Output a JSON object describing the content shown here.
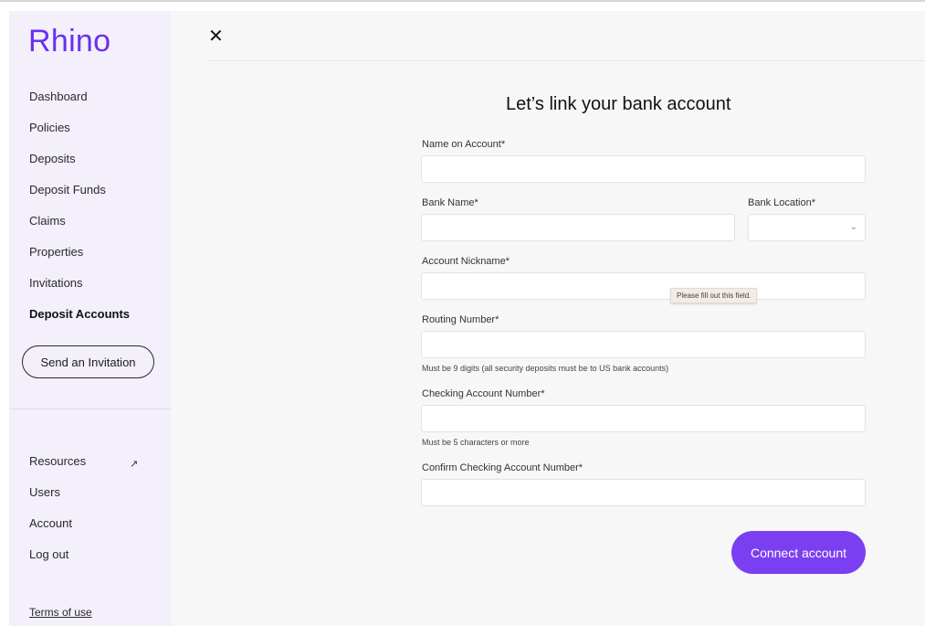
{
  "app": {
    "logo": "Rhino"
  },
  "sidebar": {
    "items": [
      {
        "label": "Dashboard"
      },
      {
        "label": "Policies"
      },
      {
        "label": "Deposits"
      },
      {
        "label": "Deposit Funds"
      },
      {
        "label": "Claims"
      },
      {
        "label": "Properties"
      },
      {
        "label": "Invitations"
      },
      {
        "label": "Deposit Accounts"
      }
    ],
    "invite_button": "Send an Invitation",
    "bottom_items": [
      {
        "label": "Resources"
      },
      {
        "label": "Users"
      },
      {
        "label": "Account"
      },
      {
        "label": "Log out"
      }
    ],
    "resources_icon": "↗",
    "terms": "Terms of use"
  },
  "header": {
    "close": "✕"
  },
  "form": {
    "title": "Let’s link your bank account",
    "name_on_account": {
      "label": "Name on Account*",
      "value": ""
    },
    "bank_name": {
      "label": "Bank Name*",
      "value": ""
    },
    "bank_location": {
      "label": "Bank Location*",
      "value": "",
      "chevron": "⌄"
    },
    "account_nickname": {
      "label": "Account Nickname*",
      "value": ""
    },
    "validation_tooltip": "Please fill out this field.",
    "routing_number": {
      "label": "Routing Number*",
      "value": "",
      "hint": "Must be 9 digits (all security deposits must be to US bank accounts)"
    },
    "checking_account": {
      "label": "Checking Account Number*",
      "value": "",
      "hint": "Must be 5 characters or more"
    },
    "confirm_checking": {
      "label": "Confirm Checking Account Number*",
      "value": ""
    },
    "submit": "Connect account"
  },
  "colors": {
    "accent": "#7b3ff2",
    "logo": "#6b2ff0",
    "sidebar_bg": "#f3effb"
  }
}
